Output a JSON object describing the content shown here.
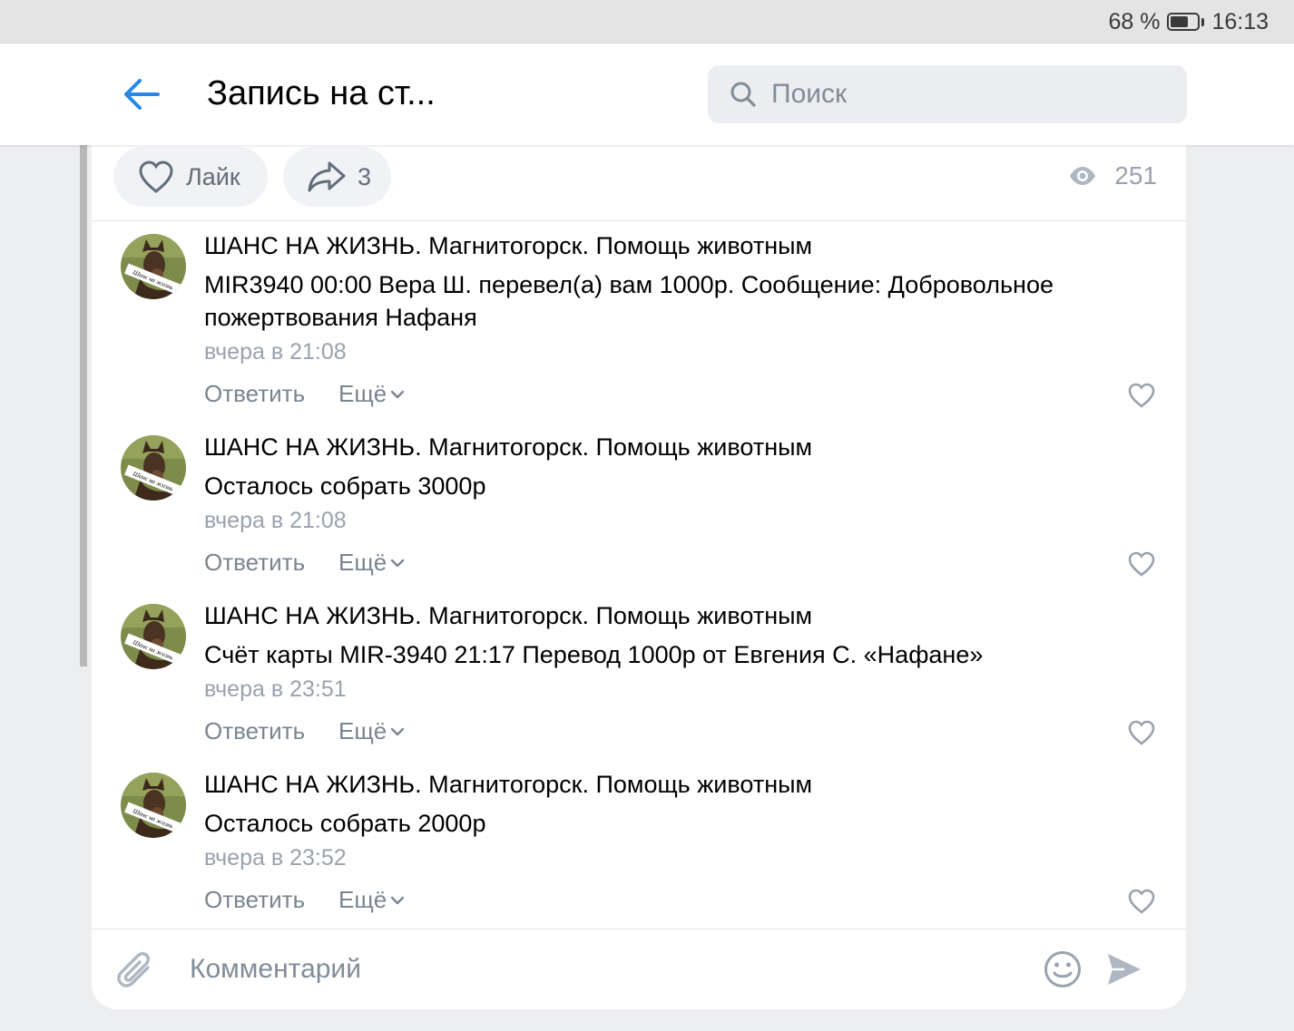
{
  "status_bar": {
    "battery_percent": "68 %",
    "battery_level": 0.68,
    "time": "16:13"
  },
  "header": {
    "title": "Запись на ст...",
    "search_placeholder": "Поиск"
  },
  "post_actions": {
    "like_label": "Лайк",
    "share_count": "3",
    "views_count": "251"
  },
  "comments": [
    {
      "author": "ШАНС НА ЖИЗНЬ. Магнитогорск. Помощь животным",
      "text": "MIR3940 00:00 Вера Ш. перевел(а) вам 1000р. Сообщение: Добровольное пожертвования Нафаня",
      "time": "вчера в 21:08",
      "reply_label": "Ответить",
      "more_label": "Ещё"
    },
    {
      "author": "ШАНС НА ЖИЗНЬ. Магнитогорск. Помощь животным",
      "text": "Осталось собрать 3000р",
      "time": "вчера в 21:08",
      "reply_label": "Ответить",
      "more_label": "Ещё"
    },
    {
      "author": "ШАНС НА ЖИЗНЬ. Магнитогорск. Помощь животным",
      "text": "Счёт карты MIR-3940 21:17 Перевод 1000р от Евгения С. «Нафане»",
      "time": "вчера в 23:51",
      "reply_label": "Ответить",
      "more_label": "Ещё"
    },
    {
      "author": "ШАНС НА ЖИЗНЬ. Магнитогорск. Помощь животным",
      "text": "Осталось собрать 2000р",
      "time": "вчера в 23:52",
      "reply_label": "Ответить",
      "more_label": "Ещё"
    }
  ],
  "avatar_label": "Шанс на жизнь",
  "composer": {
    "placeholder": "Комментарий"
  },
  "colors": {
    "accent": "#2688eb",
    "secondary_text": "#99a2ad",
    "background": "#edeef0"
  },
  "icons": [
    "back-arrow-icon",
    "search-icon",
    "heart-icon",
    "share-icon",
    "eye-icon",
    "chevron-down-icon",
    "paperclip-icon",
    "smile-icon",
    "send-icon"
  ]
}
